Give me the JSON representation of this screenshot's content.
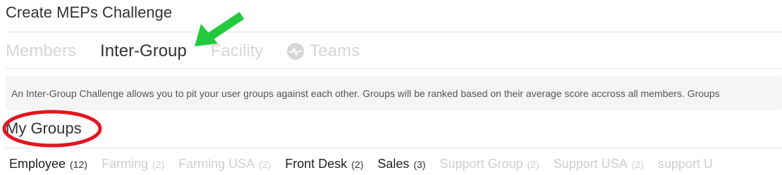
{
  "header": {
    "title": "Create MEPs Challenge"
  },
  "tabs": [
    {
      "label": "Members",
      "active": false
    },
    {
      "label": "Inter-Group",
      "active": true
    },
    {
      "label": "Facility",
      "active": false
    },
    {
      "label": "Teams",
      "active": false,
      "icon": "pulse-badge-icon"
    }
  ],
  "info": {
    "text": "An Inter-Group Challenge allows you to pit your user groups against each other. Groups will be ranked based on their average score accross all members. Groups"
  },
  "section": {
    "title": "My Groups"
  },
  "groups": [
    {
      "name": "Employee",
      "count": "(12)",
      "muted": false
    },
    {
      "name": "Farming",
      "count": "(2)",
      "muted": true
    },
    {
      "name": "Farming USA",
      "count": "(2)",
      "muted": true
    },
    {
      "name": "Front Desk",
      "count": "(2)",
      "muted": false
    },
    {
      "name": "Sales",
      "count": "(3)",
      "muted": false
    },
    {
      "name": "Support Group",
      "count": "(2)",
      "muted": true
    },
    {
      "name": "Support USA",
      "count": "(2)",
      "muted": true
    },
    {
      "name": "support U",
      "count": "",
      "muted": true
    }
  ],
  "annotations": {
    "arrow_color": "#22c93c",
    "circle_color": "#e3161f"
  },
  "colors": {
    "active_text": "#333333",
    "inactive_text": "#d6d6d6",
    "info_bg": "#f5f5f5",
    "divider": "#e2e2e2"
  }
}
